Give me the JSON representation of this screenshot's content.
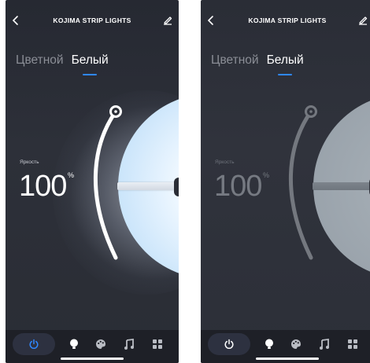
{
  "screens": [
    {
      "title": "KOJIMA STRIP LIGHTS",
      "modes": [
        "Цветной",
        "Белый"
      ],
      "active_mode": "Белый",
      "brightness_label": "Яркость",
      "brightness_value": "100",
      "brightness_unit": "%",
      "state": "on"
    },
    {
      "title": "KOJIMA STRIP LIGHTS",
      "modes": [
        "Цветной",
        "Белый"
      ],
      "active_mode": "Белый",
      "brightness_label": "Яркость",
      "brightness_value": "100",
      "brightness_unit": "%",
      "state": "off"
    }
  ],
  "nav_icons": [
    "power-icon",
    "bulb-icon",
    "palette-icon",
    "music-icon",
    "grid-icon"
  ],
  "colors": {
    "accent": "#2f88ff",
    "background": "#2a2d35",
    "nav_background": "#1e2027"
  }
}
